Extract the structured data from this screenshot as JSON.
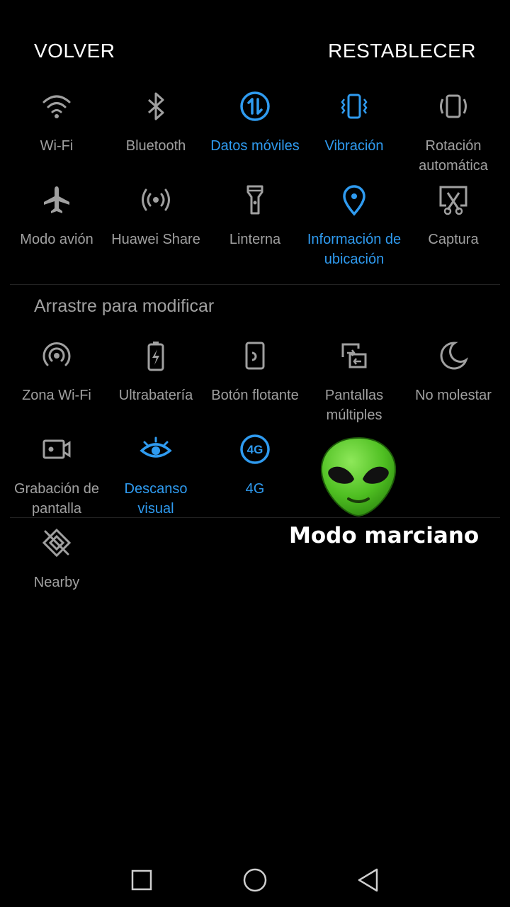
{
  "header": {
    "back_label": "VOLVER",
    "reset_label": "RESTABLECER"
  },
  "active_tiles": [
    {
      "label": "Wi-Fi",
      "icon": "wifi-icon",
      "active": false
    },
    {
      "label": "Bluetooth",
      "icon": "bluetooth-icon",
      "active": false
    },
    {
      "label": "Datos móviles",
      "icon": "mobile-data-icon",
      "active": true
    },
    {
      "label": "Vibración",
      "icon": "vibration-icon",
      "active": true
    },
    {
      "label": "Rotación automática",
      "icon": "auto-rotate-icon",
      "active": false
    },
    {
      "label": "Modo avión",
      "icon": "airplane-icon",
      "active": false
    },
    {
      "label": "Huawei Share",
      "icon": "huawei-share-icon",
      "active": false
    },
    {
      "label": "Linterna",
      "icon": "flashlight-icon",
      "active": false
    },
    {
      "label": "Información de ubicación",
      "icon": "location-icon",
      "active": true
    },
    {
      "label": "Captura",
      "icon": "screenshot-icon",
      "active": false
    }
  ],
  "hint": "Arrastre para modificar",
  "available_tiles": [
    {
      "label": "Zona Wi-Fi",
      "icon": "hotspot-icon",
      "active": false
    },
    {
      "label": "Ultrabatería",
      "icon": "battery-saver-icon",
      "active": false
    },
    {
      "label": "Botón flotante",
      "icon": "floating-button-icon",
      "active": false
    },
    {
      "label": "Pantallas múltiples",
      "icon": "multi-screen-icon",
      "active": false
    },
    {
      "label": "No molestar",
      "icon": "moon-icon",
      "active": false
    },
    {
      "label": "Grabación de pantalla",
      "icon": "screen-record-icon",
      "active": false
    },
    {
      "label": "Descanso visual",
      "icon": "eye-icon",
      "active": true
    },
    {
      "label": "4G",
      "icon": "4g-icon",
      "active": true
    },
    {
      "label": "Nearby",
      "icon": "nearby-icon",
      "active": false
    }
  ],
  "overlay": {
    "emoji": "alien-emoji",
    "caption": "Modo marciano"
  },
  "colors": {
    "background": "#000000",
    "active": "#2f9bf0",
    "inactive": "#a0a0a0",
    "header_text": "#ffffff",
    "alien_green": "#5fcf2a"
  },
  "navbar": {
    "back": "back-triangle-icon",
    "home": "home-circle-icon",
    "recents": "recents-square-icon"
  }
}
